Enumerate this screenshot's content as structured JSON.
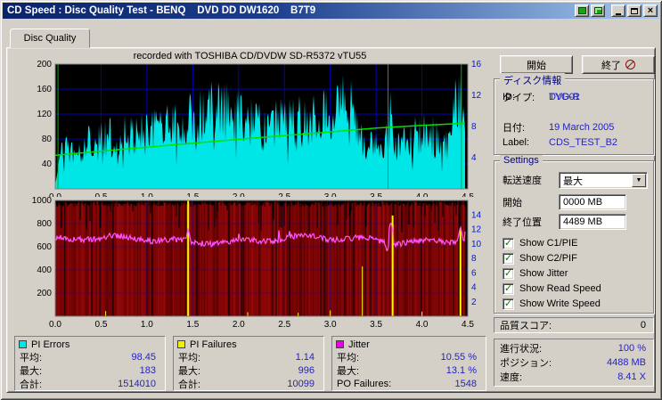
{
  "window": {
    "title": "CD Speed : Disc Quality Test - BENQ    DVD DD DW1620    B7T9"
  },
  "tab": {
    "label": "Disc Quality"
  },
  "chart_note": "recorded with TOSHIBA CD/DVDW SD-R5372 vTU55",
  "buttons": {
    "start": "開始",
    "exit": "終了"
  },
  "disc_info": {
    "title": "ディスク情報",
    "rows": [
      {
        "label": "タイプ:",
        "value": "DVD-R"
      },
      {
        "label": "ID:",
        "value": "TYG01"
      },
      {
        "label": "日付:",
        "value": "19 March 2005"
      },
      {
        "label": "Label:",
        "value": "CDS_TEST_B2"
      }
    ]
  },
  "settings": {
    "title": "Settings",
    "speed_label": "転送速度",
    "speed_value": "最大",
    "start_label": "開始",
    "start_value": "0000 MB",
    "end_label": "終了位置",
    "end_value": "4489 MB",
    "checkboxes": [
      "Show C1/PIE",
      "Show C2/PIF",
      "Show Jitter",
      "Show Read Speed",
      "Show Write Speed"
    ],
    "score_label": "品質スコア:",
    "score_value": "0"
  },
  "status": {
    "rows": [
      {
        "label": "進行状況:",
        "value": "100 %"
      },
      {
        "label": "ポジション:",
        "value": "4488 MB"
      },
      {
        "label": "速度:",
        "value": "8.41 X"
      }
    ]
  },
  "stats": {
    "pi_errors": {
      "name": "PI Errors",
      "color": "#00e5e5",
      "rows": [
        [
          "平均:",
          "98.45"
        ],
        [
          "最大:",
          "183"
        ],
        [
          "合計:",
          "1514010"
        ]
      ]
    },
    "pi_failures": {
      "name": "PI Failures",
      "color": "#f0f000",
      "rows": [
        [
          "平均:",
          "1.14"
        ],
        [
          "最大:",
          "996"
        ],
        [
          "合計:",
          "10099"
        ]
      ]
    },
    "jitter": {
      "name": "Jitter",
      "color": "#e800e8",
      "rows": [
        [
          "平均:",
          "10.55 %"
        ],
        [
          "最大:",
          "13.1 %"
        ]
      ],
      "po_label": "PO Failures:",
      "po_value": "1548"
    }
  },
  "colors": {
    "value_text": "#2222cc",
    "group_title": "#000080",
    "grid": "#0000bb",
    "plot_background": "#000000"
  },
  "chart_data": [
    {
      "type": "area",
      "title": "recorded with TOSHIBA CD/DVDW SD-R5372 vTU55",
      "x_range": [
        0,
        4.5
      ],
      "x_end": 4.47,
      "x_ticks": [
        "0.0",
        "0.5",
        "1.0",
        "1.5",
        "2.0",
        "2.5",
        "3.0",
        "3.5",
        "4.0",
        "4.5"
      ],
      "left_axis": {
        "name": "PI Errors",
        "range": [
          0,
          200
        ],
        "ticks": [
          200,
          160,
          120,
          80,
          40
        ]
      },
      "right_axis": {
        "name": "Read Speed (X)",
        "range": [
          0,
          16
        ],
        "ticks": [
          16,
          12,
          8,
          4
        ]
      },
      "pi_errors": {
        "color": "#00e5e5",
        "avg": 98.45,
        "max": 183,
        "total": 1514010,
        "envelope": [
          [
            0,
            10
          ],
          [
            0.05,
            85
          ],
          [
            0.3,
            100
          ],
          [
            0.5,
            114
          ],
          [
            0.8,
            120
          ],
          [
            1.0,
            129
          ],
          [
            1.3,
            140
          ],
          [
            1.5,
            157
          ],
          [
            1.7,
            178
          ],
          [
            1.9,
            172
          ],
          [
            2.1,
            150
          ],
          [
            2.3,
            140
          ],
          [
            2.5,
            152
          ],
          [
            2.7,
            150
          ],
          [
            2.9,
            158
          ],
          [
            3.1,
            180
          ],
          [
            3.25,
            192
          ],
          [
            3.35,
            110
          ],
          [
            3.5,
            90
          ],
          [
            3.6,
            95
          ],
          [
            3.65,
            200
          ],
          [
            3.7,
            100
          ],
          [
            3.9,
            115
          ],
          [
            4.05,
            125
          ],
          [
            4.15,
            120
          ],
          [
            4.25,
            90
          ],
          [
            4.35,
            195
          ],
          [
            4.42,
            190
          ],
          [
            4.47,
            140
          ]
        ]
      },
      "read_speed": {
        "color": "#00e000",
        "end_speed": 8.41,
        "points": [
          [
            0,
            4.3
          ],
          [
            0.5,
            4.85
          ],
          [
            1.0,
            5.35
          ],
          [
            1.5,
            5.85
          ],
          [
            2.0,
            6.35
          ],
          [
            2.5,
            6.85
          ],
          [
            3.0,
            7.3
          ],
          [
            3.5,
            7.8
          ],
          [
            4.0,
            8.15
          ],
          [
            4.47,
            8.41
          ]
        ],
        "vertical_lines": [
          0.03,
          3.63,
          4.43
        ]
      }
    },
    {
      "type": "line",
      "x_range": [
        0,
        4.5
      ],
      "x_end": 4.47,
      "x_ticks": [
        "0.0",
        "0.5",
        "1.0",
        "1.5",
        "2.0",
        "2.5",
        "3.0",
        "3.5",
        "4.0",
        "4.5"
      ],
      "left_axis": {
        "name": "PI Failures",
        "range": [
          0,
          1000
        ],
        "ticks": [
          1000,
          800,
          600,
          400,
          200
        ]
      },
      "right_axis": {
        "name": "Jitter %",
        "range": [
          0,
          16
        ],
        "ticks": [
          14,
          12,
          10,
          8,
          6,
          4,
          2
        ]
      },
      "po_failures": {
        "color": "#7c0404",
        "total": 1548
      },
      "pi_failures": {
        "color": "#ffff00",
        "avg": 1.14,
        "max": 996,
        "total": 10099,
        "spikes": [
          [
            0.55,
            45
          ],
          [
            1.45,
            996
          ],
          [
            2.1,
            35
          ],
          [
            2.65,
            30
          ],
          [
            3.0,
            50
          ],
          [
            3.35,
            430
          ],
          [
            3.68,
            870
          ],
          [
            4.0,
            40
          ],
          [
            4.42,
            760
          ]
        ]
      },
      "jitter": {
        "color": "#ff55ff",
        "avg_pct": 10.55,
        "max_pct": 13.1,
        "spikes": [
          [
            1.45,
            12.1
          ],
          [
            3.66,
            13.1
          ],
          [
            4.42,
            12.4
          ]
        ],
        "dips": [
          [
            3.62,
            8.8
          ]
        ]
      }
    }
  ]
}
